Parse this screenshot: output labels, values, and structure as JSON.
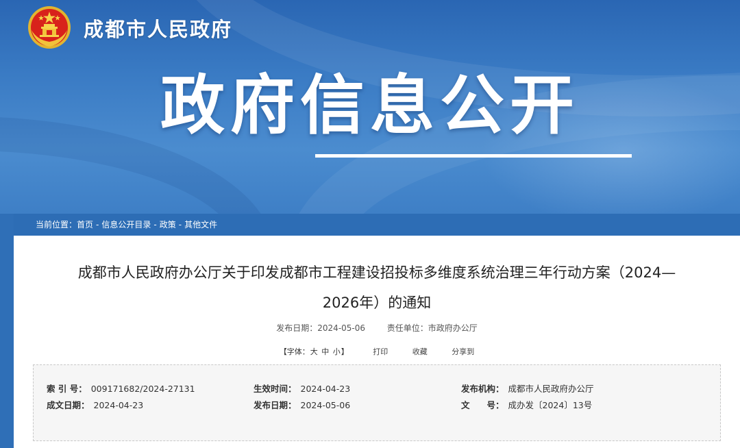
{
  "site": {
    "name": "成都市人民政府",
    "banner_title": "政府信息公开"
  },
  "breadcrumb": {
    "prefix": "当前位置：",
    "items": [
      "首页",
      "信息公开目录",
      "政策",
      "其他文件"
    ],
    "separator": " - "
  },
  "document": {
    "title_line1": "成都市人民政府办公厅关于印发成都市工程建设招投标多维度系统治理三年行动方案（2024—",
    "title_line2": "2026年）的通知",
    "publish_label": "发布日期：",
    "publish_date": "2024-05-06",
    "unit_label": "责任单位：",
    "unit": "市政府办公厅"
  },
  "tools": {
    "font_label": "【字体：",
    "font_large": "大",
    "font_medium": "中",
    "font_small": "小",
    "font_close": "】",
    "print": "打印",
    "favorite": "收藏",
    "share": "分享到"
  },
  "info": {
    "index_label": "索 引 号：",
    "index_value": "009171682/2024-27131",
    "effective_label": "生效时间：",
    "effective_value": "2024-04-23",
    "issuer_label": "发布机构：",
    "issuer_value": "成都市人民政府办公厅",
    "written_label": "成文日期：",
    "written_value": "2024-04-23",
    "pub_label": "发布日期：",
    "pub_value": "2024-05-06",
    "docno_label": "文　　号：",
    "docno_value": "成办发〔2024〕13号"
  },
  "colors": {
    "banner": "#2f6fb7",
    "breadcrumb_bar": "#2d6db5",
    "emblem_red": "#d8221b",
    "emblem_gold": "#f2c33a"
  }
}
